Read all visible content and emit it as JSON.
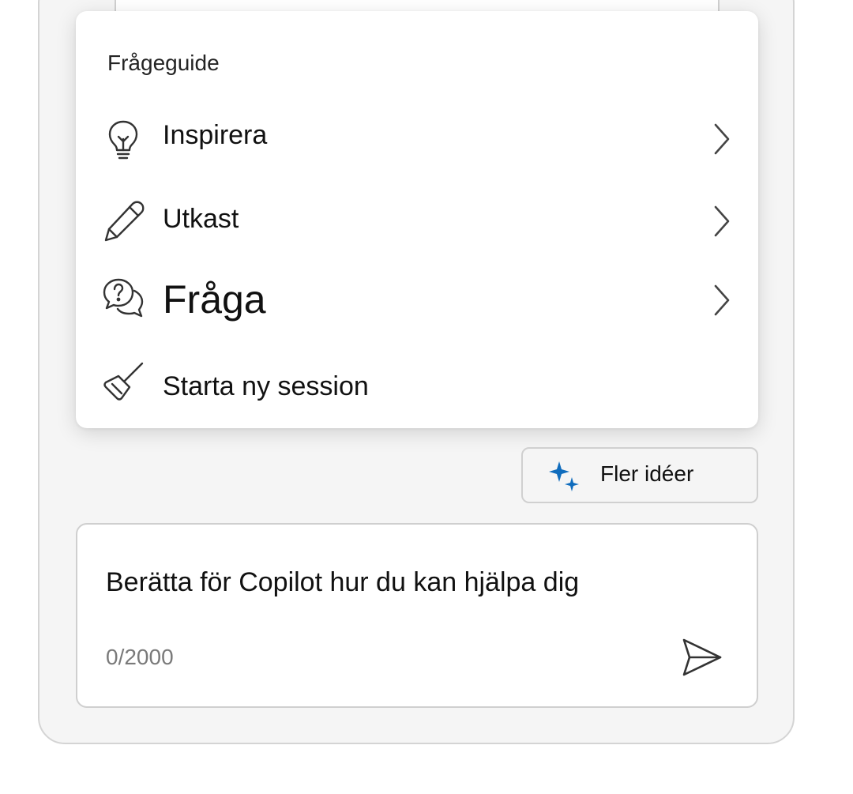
{
  "menu": {
    "title": "Frågeguide",
    "items": [
      {
        "label": "Inspirera",
        "icon": "lightbulb-icon",
        "has_submenu": true
      },
      {
        "label": "Utkast",
        "icon": "pencil-icon",
        "has_submenu": true
      },
      {
        "label": "Fråga",
        "icon": "question-chat-icon",
        "has_submenu": true
      },
      {
        "label": "Starta ny session",
        "icon": "broom-icon",
        "has_submenu": false
      }
    ]
  },
  "more_ideas": {
    "label": "Fler idéer",
    "icon": "sparkle-icon",
    "icon_color": "#0f6cbd"
  },
  "composer": {
    "placeholder": "Berätta för Copilot hur du kan hjälpa dig",
    "counter": "0/2000",
    "send_icon": "send-icon"
  },
  "colors": {
    "pane_background": "#f5f5f5",
    "card_background": "#ffffff",
    "border": "#d0d0d0",
    "accent": "#0f6cbd"
  }
}
